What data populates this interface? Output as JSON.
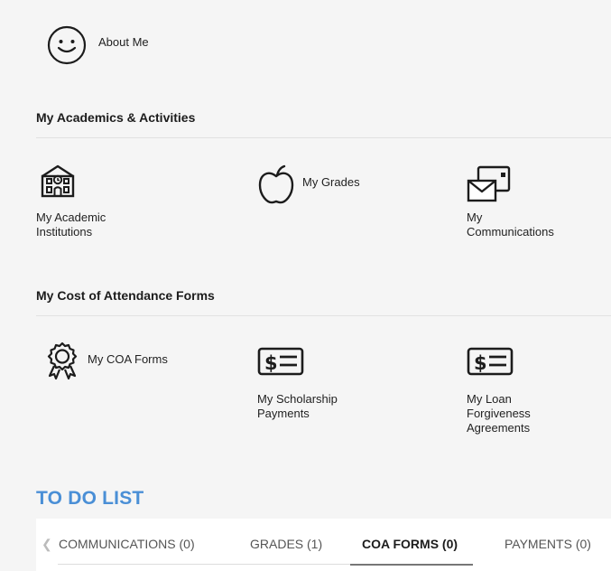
{
  "about": {
    "label": "About Me",
    "icon": "smiley-face-icon"
  },
  "academics": {
    "title": "My Academics & Activities",
    "items": [
      {
        "label": "My Academic Institutions",
        "icon": "school-building-icon"
      },
      {
        "label": "My Grades",
        "icon": "apple-icon"
      },
      {
        "label": "My Communications",
        "icon": "envelope-mail-icon"
      }
    ]
  },
  "coa": {
    "title": "My Cost of Attendance Forms",
    "items": [
      {
        "label": "My COA Forms",
        "icon": "award-ribbon-icon"
      },
      {
        "label": "My Scholarship Payments",
        "icon": "dollar-card-icon"
      },
      {
        "label": "My Loan Forgiveness Agreements",
        "icon": "dollar-card-icon"
      }
    ]
  },
  "todo": {
    "title": "TO DO LIST",
    "tabs": [
      "COMMUNICATIONS (0)",
      "GRADES (1)",
      "COA FORMS (0)",
      "PAYMENTS (0)"
    ],
    "active_tab": "COA FORMS (0)"
  },
  "colors": {
    "accent": "#4a8fd6",
    "panel_bg": "#f5f5f5",
    "text": "#222222"
  }
}
